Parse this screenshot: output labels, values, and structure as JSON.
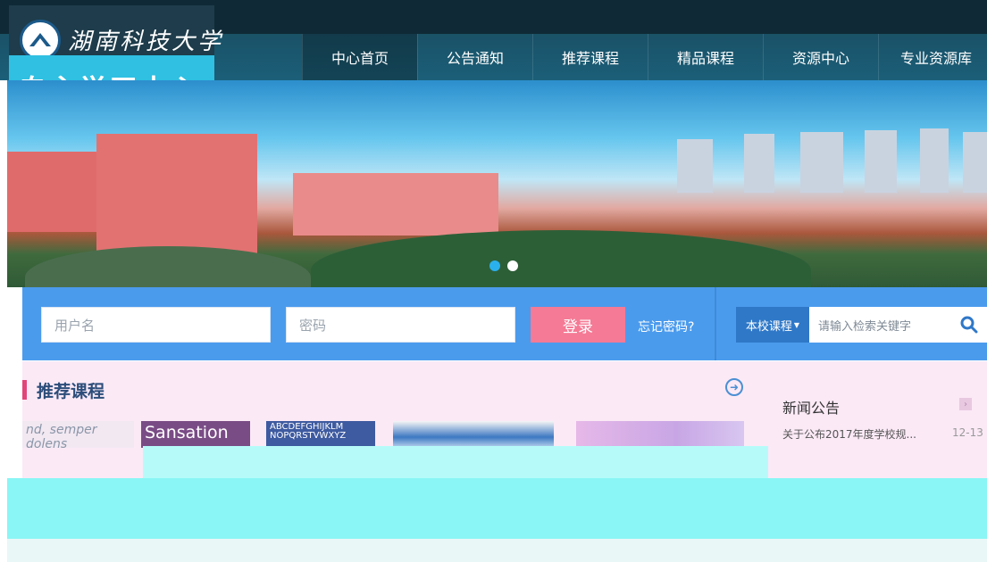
{
  "header": {
    "school_name": "湖南科技大学",
    "subtitle": "自主学习中心"
  },
  "nav": {
    "items": [
      {
        "label": "中心首页",
        "active": true
      },
      {
        "label": "公告通知",
        "active": false
      },
      {
        "label": "推荐课程",
        "active": false
      },
      {
        "label": "精品课程",
        "active": false
      },
      {
        "label": "资源中心",
        "active": false
      },
      {
        "label": "专业资源库",
        "active": false
      }
    ]
  },
  "carousel": {
    "slide_count": 2,
    "active_index": 0
  },
  "login": {
    "username_placeholder": "用户名",
    "password_placeholder": "密码",
    "login_label": "登录",
    "forgot_label": "忘记密码?"
  },
  "search": {
    "scope_label": "本校课程",
    "placeholder": "请输入检索关键字"
  },
  "recommended": {
    "title": "推荐课程",
    "courses": [
      {
        "thumb_text": "nd, semper dolens"
      },
      {
        "thumb_text": "Sansation"
      },
      {
        "thumb_text": "ABCDEFGHIJKLM NOPQRSTVWXYZ"
      },
      {
        "thumb_text": ""
      },
      {
        "thumb_text": ""
      }
    ]
  },
  "news": {
    "title": "新闻公告",
    "items": [
      {
        "text": "关于公布2017年度学校规...",
        "date": "12-13"
      }
    ]
  },
  "colors": {
    "nav_bg": "#1b5f78",
    "login_bar": "#4b9bed",
    "login_button": "#f57a95",
    "accent_bar": "#e1457a",
    "section_title": "#2c4d7a"
  }
}
